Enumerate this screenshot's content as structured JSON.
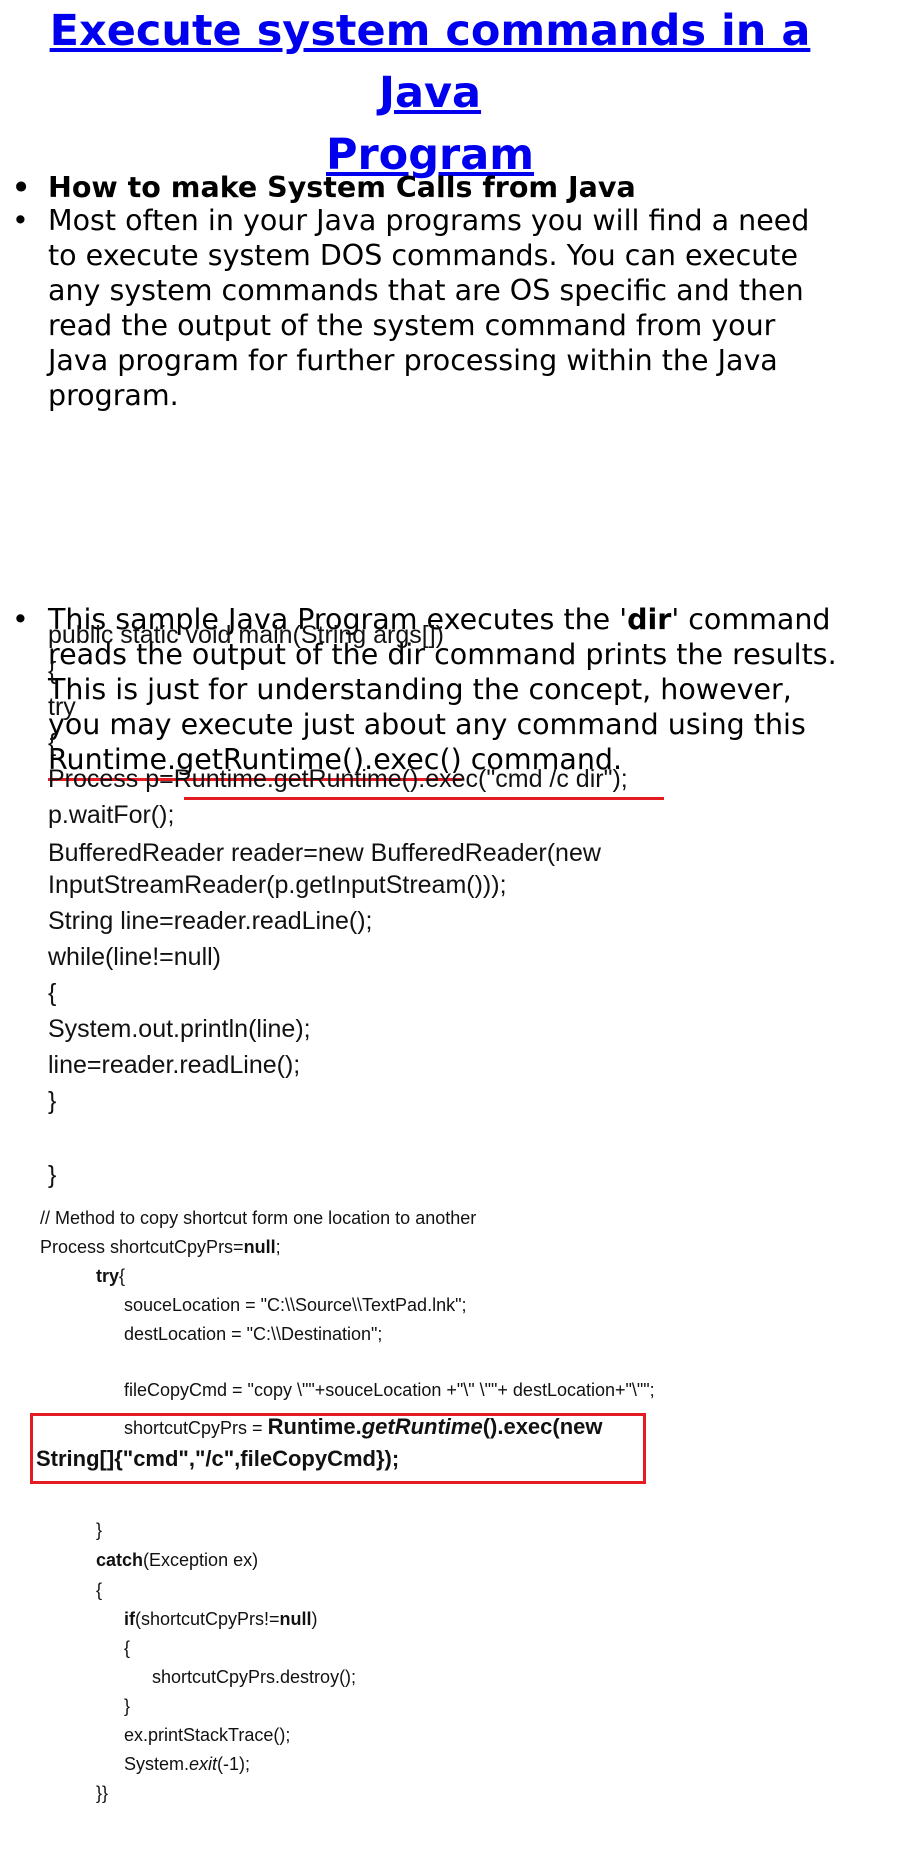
{
  "title": {
    "line1": "Execute system commands in a Java",
    "line2": "Program"
  },
  "bullets": {
    "b1": "How to make System Calls from Java",
    "b2_lines": [
      "Most often in your Java programs you will find a need",
      "to execute system DOS commands. You can execute",
      "any system commands that are OS specific and then",
      "read the output of the system command from your",
      "Java program for further processing within the Java",
      "program."
    ],
    "b3": {
      "l1_pre": "This sample Java Program executes the '",
      "l1_bold": "dir",
      "l1_post": "' command",
      "l2": "reads the output of the dir command prints the results.",
      "l3": "This is just for understanding the concept, however,",
      "l4": "you may execute just about any command using this",
      "l5_underlined": "Runtime.getRuntime().exec()",
      "l5_rest": " command."
    }
  },
  "code1": [
    "public static void main(String args[])",
    "{",
    "try",
    "{",
    "Process p=Runtime.getRuntime().exec(\"cmd  /c dir\");",
    "p.waitFor();",
    "BufferedReader  reader=new  BufferedReader(new",
    "InputStreamReader(p.getInputStream()));",
    "String line=reader.readLine();",
    "while(line!=null)",
    "{",
    "System.out.println(line);",
    "line=reader.readLine();",
    "}",
    "}"
  ],
  "code2": {
    "comment": "//  Method to copy shortcut form one location to another",
    "decl_pre": "Process shortcutCpyPrs=",
    "decl_null": "null",
    "decl_end": ";",
    "try_kw": "try",
    "try_brace": "{",
    "src": "souceLocation = \"C:\\\\Source\\\\TextPad.lnk\";",
    "dest": "destLocation = \"C:\\\\Destination\";",
    "copycmd": "fileCopyCmd = \"copy \\\"\"+souceLocation +\"\\\" \\\"\"+ destLocation+\"\\\"\";",
    "exec_pre": "shortcutCpyPrs = ",
    "exec_a": "Runtime.",
    "exec_b": "getRuntime",
    "exec_c": "().exec(new",
    "exec_line2": "String[]{\"cmd\",\"/c\",fileCopyCmd});",
    "close1": "}",
    "catch_kw": "catch",
    "catch_rest": "(Exception ex)",
    "open2": "{",
    "if_kw": "if",
    "if_rest": "(shortcutCpyPrs!=",
    "if_null": "null",
    "if_end": ")",
    "open3": "{",
    "destroy": "shortcutCpyPrs.destroy();",
    "close3": "}",
    "trace": "ex.printStackTrace();",
    "exit_pre": "System.",
    "exit_it": "exit",
    "exit_post": "(-1);",
    "final": "}}"
  },
  "colors": {
    "title": "#0000ee",
    "highlight": "#e31b23"
  }
}
